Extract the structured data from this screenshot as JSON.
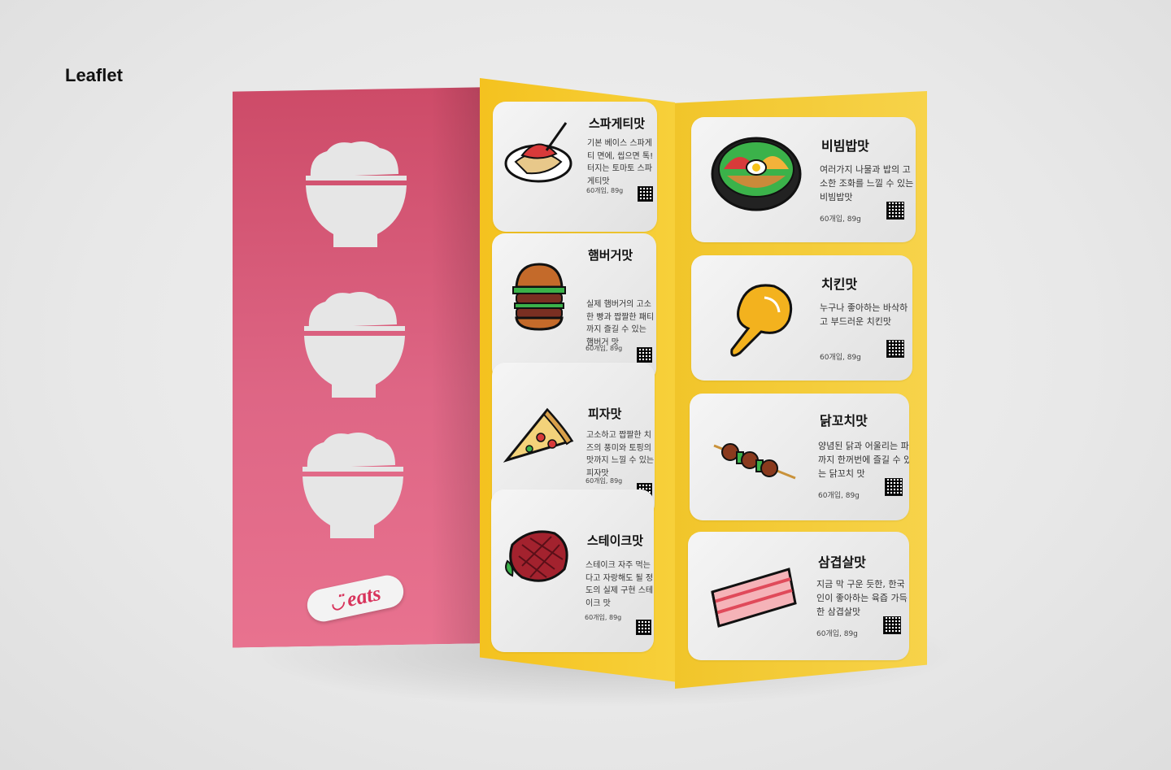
{
  "page_title": "Leaflet",
  "brand": "eats",
  "middle_cards": [
    {
      "name": "스파게티맛",
      "desc": "기본 베이스 스파게티 면에, 씹으면 톡! 터지는 토마토 스파게티맛",
      "qty": "60개입, 89g",
      "icon": "spaghetti-icon"
    },
    {
      "name": "햄버거맛",
      "desc": "실제 햄버거의 고소한 빵과 짭짤한 패티까지 즐길 수 있는 햄버거 맛",
      "qty": "60개입, 89g",
      "icon": "hamburger-icon"
    },
    {
      "name": "피자맛",
      "desc": "고소하고 짭짤한 치즈의 풍미와 토핑의 맛까지 느낄 수 있는 피자맛",
      "qty": "60개입, 89g",
      "icon": "pizza-icon"
    },
    {
      "name": "스테이크맛",
      "desc": "스테이크 자주 먹는다고 자랑해도 될 정도의 실제 구현 스테이크 맛",
      "qty": "60개입, 89g",
      "icon": "steak-icon"
    }
  ],
  "right_cards": [
    {
      "name": "비빔밥맛",
      "desc": "여러가지 나물과 밥의 고소한 조화를 느낄 수 있는 비빔밥맛",
      "qty": "60개입, 89g",
      "icon": "bibimbap-icon"
    },
    {
      "name": "치킨맛",
      "desc": "누구나 좋아하는 바삭하고 부드러운 치킨맛",
      "qty": "60개입, 89g",
      "icon": "chicken-icon"
    },
    {
      "name": "닭꼬치맛",
      "desc": "양념된 닭과 어울리는 파까지 한꺼번에 즐길 수 있는 닭꼬치 맛",
      "qty": "60개입, 89g",
      "icon": "chicken-skewer-icon"
    },
    {
      "name": "삼겹살맛",
      "desc": "지금 막 구운 듯한, 한국인이 좋아하는 육즙 가득한 삼겹살맛",
      "qty": "60개입, 89g",
      "icon": "pork-belly-icon"
    }
  ],
  "colors": {
    "pink_panel": "#d9577a",
    "yellow_panel": "#f5c82c",
    "card": "#ececec",
    "rice_bowl": "#e6e6e6",
    "brand_red": "#d8345c"
  }
}
